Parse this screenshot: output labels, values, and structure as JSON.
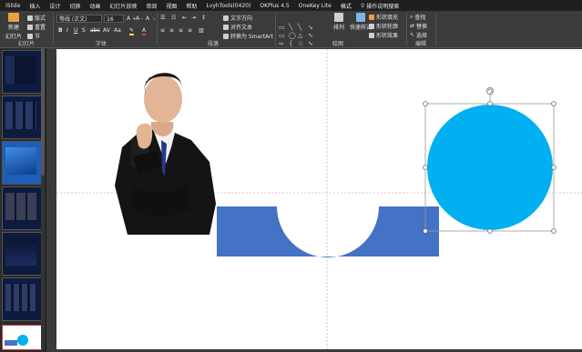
{
  "menubar": {
    "tabs": [
      "iSlide",
      "插入",
      "设计",
      "切换",
      "动画",
      "幻灯片放映",
      "审阅",
      "视图",
      "帮助",
      "LvyhTools(0420)",
      "OKPlus 4.5",
      "OneKey Lite",
      "格式"
    ],
    "tell_me": "操作说明搜索"
  },
  "ribbon": {
    "new_slide": "新建",
    "new_slide_sub": "幻灯片",
    "layout": "版式",
    "reset": "重置",
    "section": "节",
    "font_name": "等线 (正文)",
    "font_size": "16",
    "groups": {
      "slides": "幻灯片",
      "font": "字体",
      "paragraph": "段落",
      "drawing": "绘图",
      "editing": "编辑"
    },
    "text_direction": "文字方向",
    "align_text": "对齐文本",
    "smartart": "转换为 SmartArt",
    "arrange": "排列",
    "quick_styles": "快速样式",
    "shape_fill": "形状填充",
    "shape_outline": "形状轮廓",
    "shape_effects": "形状效果",
    "find": "查找",
    "replace": "替换",
    "select": "选择"
  },
  "colors": {
    "blue_rect": "#4472c4",
    "circle": "#00b0f0",
    "slide_bg": "#ffffff",
    "app_bg": "#2b2b2b"
  }
}
